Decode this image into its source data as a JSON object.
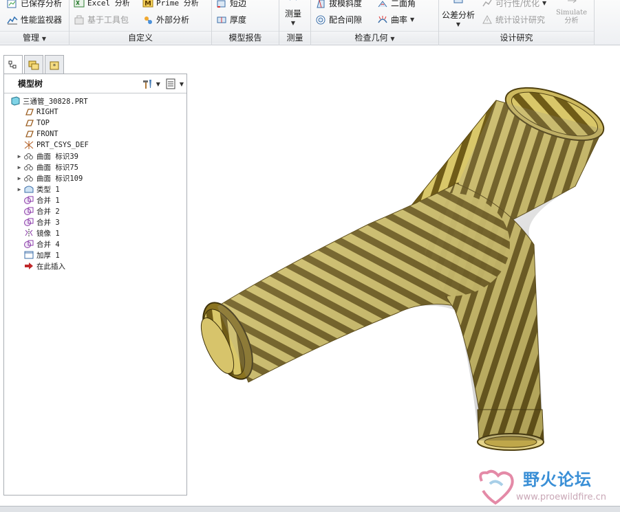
{
  "ribbon": {
    "groups": {
      "manage": {
        "label": "管理",
        "saved_analysis": "已保存分析",
        "performance_monitor": "性能监视器"
      },
      "custom": {
        "label": "自定义",
        "excel_analysis": "Excel 分析",
        "prime_analysis": "Prime 分析",
        "toolkit_based": "基于工具包",
        "external_analysis": "外部分析"
      },
      "model_report": {
        "label": "模型报告",
        "short_edge": "短边",
        "thickness": "厚度"
      },
      "measure": {
        "label": "测量",
        "measure_button": "测量"
      },
      "inspect_geometry": {
        "label": "检查几何",
        "draft": "拔模斜度",
        "mating_clearance": "配合间隙",
        "dihedral_angle": "二面角",
        "curvature": "曲率"
      },
      "design_study": {
        "label": "设计研究",
        "tolerance_analysis": "公差分析",
        "feasibility": "可行性/优化",
        "statistical_study": "统计设计研究",
        "simulate_line1": "Simulate",
        "simulate_line2": "分析"
      }
    }
  },
  "model_tree": {
    "title": "模型树",
    "nodes": [
      {
        "label": "三通管_30828.PRT",
        "icon": "part-icon",
        "expandable": false
      },
      {
        "label": "RIGHT",
        "icon": "datum-plane-icon",
        "expandable": false
      },
      {
        "label": "TOP",
        "icon": "datum-plane-icon",
        "expandable": false
      },
      {
        "label": "FRONT",
        "icon": "datum-plane-icon",
        "expandable": false
      },
      {
        "label": "PRT_CSYS_DEF",
        "icon": "csys-icon",
        "expandable": false
      },
      {
        "label": "曲面 标识39",
        "icon": "surface-icon",
        "expandable": true
      },
      {
        "label": "曲面 标识75",
        "icon": "surface-icon",
        "expandable": true
      },
      {
        "label": "曲面 标识109",
        "icon": "surface-icon",
        "expandable": true
      },
      {
        "label": "类型 1",
        "icon": "style-icon",
        "expandable": true
      },
      {
        "label": "合并 1",
        "icon": "merge-icon",
        "expandable": false
      },
      {
        "label": "合并 2",
        "icon": "merge-icon",
        "expandable": false
      },
      {
        "label": "合并 3",
        "icon": "merge-icon",
        "expandable": false
      },
      {
        "label": "镜像 1",
        "icon": "mirror-icon",
        "expandable": false
      },
      {
        "label": "合并 4",
        "icon": "merge-icon",
        "expandable": false
      },
      {
        "label": "加厚 1",
        "icon": "thicken-icon",
        "expandable": false
      },
      {
        "label": "在此插入",
        "icon": "insert-here-icon",
        "expandable": false
      }
    ]
  },
  "watermark": {
    "title": "野火论坛",
    "url": "www.proewildfire.cn"
  },
  "colors": {
    "stripe_dark": "#6e5a16",
    "stripe_light": "#d8c56a",
    "accent_blue": "#3a8fd6"
  }
}
